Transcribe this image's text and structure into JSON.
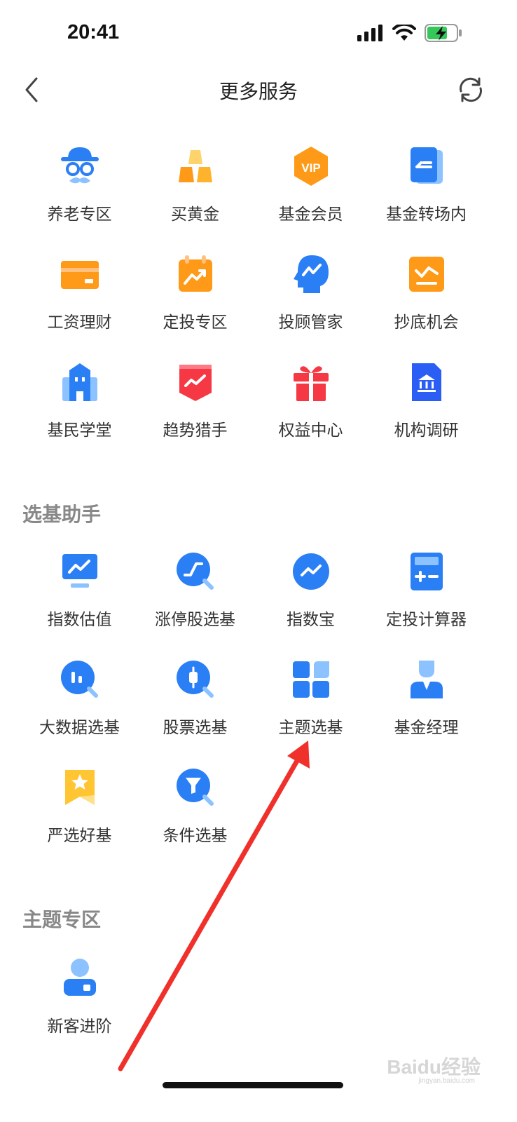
{
  "status_bar": {
    "time": "20:41"
  },
  "nav": {
    "title": "更多服务"
  },
  "services": [
    {
      "label": "养老专区",
      "icon": "retirement-icon"
    },
    {
      "label": "买黄金",
      "icon": "gold-bars-icon"
    },
    {
      "label": "基金会员",
      "icon": "vip-icon",
      "badge": "VIP"
    },
    {
      "label": "基金转场内",
      "icon": "transfer-icon"
    },
    {
      "label": "工资理财",
      "icon": "card-icon"
    },
    {
      "label": "定投专区",
      "icon": "calendar-chart-icon"
    },
    {
      "label": "投顾管家",
      "icon": "advisor-head-icon"
    },
    {
      "label": "抄底机会",
      "icon": "check-chart-icon"
    },
    {
      "label": "基民学堂",
      "icon": "school-building-icon"
    },
    {
      "label": "趋势猎手",
      "icon": "trend-banner-icon"
    },
    {
      "label": "权益中心",
      "icon": "gift-icon"
    },
    {
      "label": "机构调研",
      "icon": "institution-icon"
    }
  ],
  "fund_helper": {
    "title": "选基助手",
    "items": [
      {
        "label": "指数估值",
        "icon": "monitor-chart-icon"
      },
      {
        "label": "涨停股选基",
        "icon": "search-trend-icon"
      },
      {
        "label": "指数宝",
        "icon": "index-circle-icon"
      },
      {
        "label": "定投计算器",
        "icon": "calculator-icon"
      },
      {
        "label": "大数据选基",
        "icon": "search-bars-icon"
      },
      {
        "label": "股票选基",
        "icon": "search-candle-icon"
      },
      {
        "label": "主题选基",
        "icon": "tiles-icon"
      },
      {
        "label": "基金经理",
        "icon": "manager-icon"
      },
      {
        "label": "严选好基",
        "icon": "star-badge-icon"
      },
      {
        "label": "条件选基",
        "icon": "search-filter-icon"
      }
    ]
  },
  "theme_zone": {
    "title": "主题专区",
    "items": [
      {
        "label": "新客进阶",
        "icon": "new-user-icon"
      }
    ]
  },
  "watermark": {
    "text": "Baidu经验",
    "sub": "jingyan.baidu.com"
  },
  "colors": {
    "blue": "#2b7ff5",
    "light_blue": "#8cc2ff",
    "orange": "#ff9a18",
    "red": "#f53844",
    "yellow": "#ffc532"
  }
}
